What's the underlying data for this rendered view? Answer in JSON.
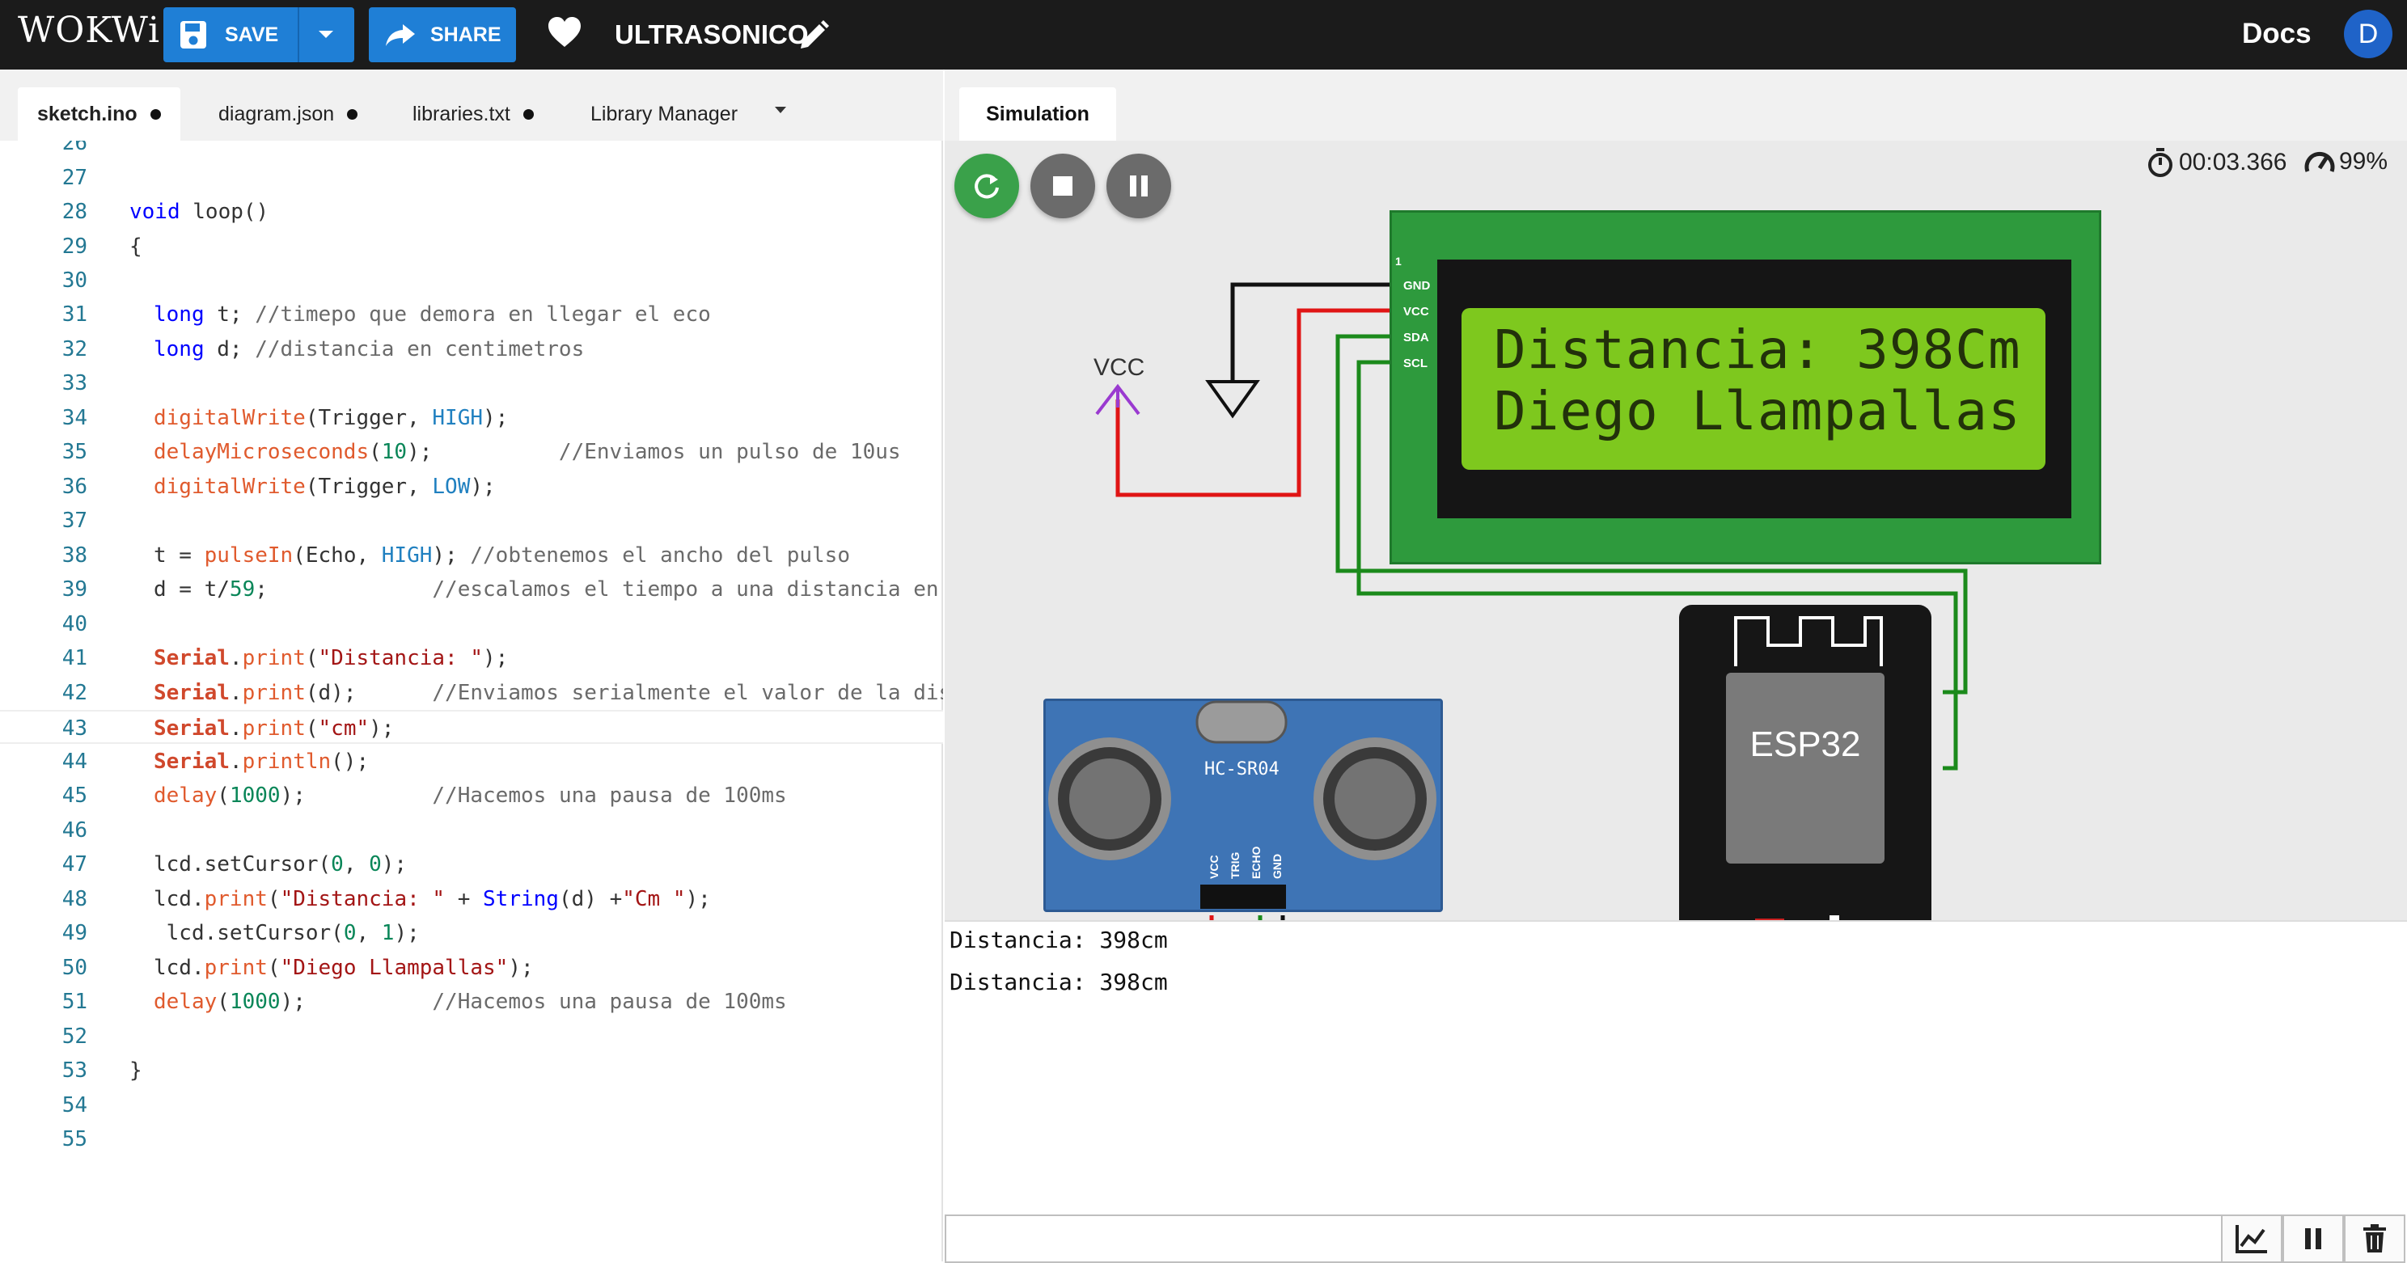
{
  "header": {
    "logo": "WOKWi",
    "save_label": "SAVE",
    "share_label": "SHARE",
    "project_title": "ULTRASONICO",
    "docs_label": "Docs",
    "avatar_initial": "D"
  },
  "editor": {
    "tabs": [
      {
        "label": "sketch.ino",
        "unsaved": true
      },
      {
        "label": "diagram.json",
        "unsaved": true
      },
      {
        "label": "libraries.txt",
        "unsaved": true
      },
      {
        "label": "Library Manager",
        "unsaved": false
      }
    ],
    "line_numbers": [
      "26",
      "27",
      "28",
      "29",
      "30",
      "31",
      "32",
      "33",
      "34",
      "35",
      "36",
      "37",
      "38",
      "39",
      "40",
      "41",
      "42",
      "43",
      "44",
      "45",
      "46",
      "47",
      "48",
      "49",
      "50",
      "51",
      "52",
      "53",
      "54",
      "55"
    ],
    "code": {
      "l28": [
        "void",
        " loop()"
      ],
      "l29": "{",
      "l31": [
        "long",
        " t; ",
        "//timepo que demora en llegar el eco"
      ],
      "l32": [
        "long",
        " d; ",
        "//distancia en centimetros"
      ],
      "l34": [
        "digitalWrite",
        "(Trigger, ",
        "HIGH",
        ");"
      ],
      "l35": [
        "delayMicroseconds",
        "(",
        "10",
        ");",
        "          //Enviamos un pulso de 10us"
      ],
      "l36": [
        "digitalWrite",
        "(Trigger, ",
        "LOW",
        ");"
      ],
      "l38": [
        "t = ",
        "pulseIn",
        "(Echo, ",
        "HIGH",
        "); ",
        "//obtenemos el ancho del pulso"
      ],
      "l39": [
        "d = t/",
        "59",
        ";",
        "             //escalamos el tiempo a una distancia en cm"
      ],
      "l41": [
        "Serial",
        ".",
        "print",
        "(",
        "\"Distancia: \"",
        ");"
      ],
      "l42": [
        "Serial",
        ".",
        "print",
        "(d);",
        "      //Enviamos serialmente el valor de la distancia"
      ],
      "l43": [
        "Serial",
        ".",
        "print",
        "(",
        "\"cm\"",
        ");"
      ],
      "l44": [
        "Serial",
        ".",
        "println",
        "();"
      ],
      "l45": [
        "delay",
        "(",
        "1000",
        ");",
        "          //Hacemos una pausa de 100ms"
      ],
      "l47": [
        "lcd.setCursor(",
        "0",
        ", ",
        "0",
        ");"
      ],
      "l48": [
        "lcd.",
        "print",
        "(",
        "\"Distancia: \"",
        " + ",
        "String",
        "(d) +",
        "\"Cm \"",
        ");"
      ],
      "l49": [
        " lcd.setCursor(",
        "0",
        ", ",
        "1",
        ");"
      ],
      "l50": [
        "lcd.",
        "print",
        "(",
        "\"Diego Llampallas\"",
        ");"
      ],
      "l51": [
        "delay",
        "(",
        "1000",
        ");",
        "          //Hacemos una pausa de 100ms"
      ],
      "l53": "}"
    }
  },
  "simulation": {
    "tab_label": "Simulation",
    "timer": "00:03.366",
    "performance": "99%",
    "lcd": {
      "row1": "Distancia: 398Cm",
      "row2": "Diego Llampallas",
      "pins": [
        "GND",
        "VCC",
        "SDA",
        "SCL"
      ],
      "pin_number": "1"
    },
    "vcc_label": "VCC",
    "sensor": {
      "name": "HC-SR04",
      "pins": [
        "VCC",
        "TRIG",
        "ECHO",
        "GND"
      ]
    },
    "board": {
      "name": "ESP32"
    }
  },
  "serial_monitor": {
    "lines": [
      "Distancia: 398cm",
      "Distancia: 398cm"
    ],
    "input_value": ""
  },
  "colors": {
    "header_bg": "#1b1b1b",
    "button_blue": "#1f7fd6",
    "run_green": "#3aa14a",
    "lcd_green": "#7ec81e",
    "board_green": "#2e9a3d",
    "sensor_blue": "#3e74b5"
  },
  "icons": [
    "save-icon",
    "chevron-down-icon",
    "share-icon",
    "heart-icon",
    "pencil-icon",
    "restart-icon",
    "stop-icon",
    "pause-icon",
    "stopwatch-icon",
    "speedometer-icon",
    "chart-icon",
    "pause-icon",
    "trash-icon"
  ]
}
